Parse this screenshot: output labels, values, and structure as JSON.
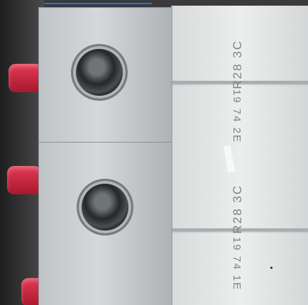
{
  "scene": {
    "description_hidden": ""
  },
  "breakers": [
    {
      "upper_label": "R28 3C",
      "lower_label": "19 74 2E"
    },
    {
      "upper_label": "R28 3C",
      "lower_label": "19 74 1E"
    }
  ],
  "colors": {
    "red": "#d2323f",
    "housing": "#e3e5e6",
    "terminal": "#c7cbcd",
    "dark": "#2a2a2a"
  }
}
